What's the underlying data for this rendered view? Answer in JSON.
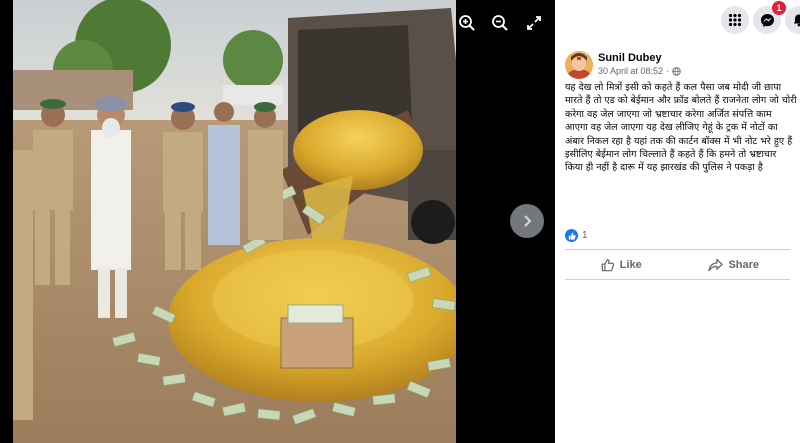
{
  "post": {
    "author_name": "Sunil Dubey",
    "timestamp": "30 April at 08:52",
    "privacy_icon": "globe-icon",
    "text": "यह देख लो मित्रों इसी को कहते हैं कल पैसा जब मोदी जी छापा मारते हैं तो एड को बेईमान और फ्रॉड बोलते हैं राजनेता लोग जो चोरी करेगा वह जेल जाएगा जो भ्रष्टाचार करेगा अर्जित संपत्ति काम आएगा वह जेल जाएगा यह देख लीजिए गेहूं के ट्रक में नोटों का अंबार निकल रहा है यहां तक की कार्टन बॉक्स में भी नोट भरे हुए हैं इसीलिए बेईमान लोग चिल्लाते हैं कहते हैं कि हमने तो भ्रष्टाचार किया ही नहीं है दारू में यह झारखंड की पुलिस ने पकड़ा है",
    "reaction_count": "1",
    "like_label": "Like",
    "share_label": "Share"
  },
  "topbar": {
    "menu_icon": "grid-menu-icon",
    "messenger_icon": "messenger-icon",
    "messenger_badge": "1",
    "notifications_icon": "bell-icon"
  },
  "viewer": {
    "zoom_in_icon": "zoom-in-icon",
    "zoom_out_icon": "zoom-out-icon",
    "fullscreen_icon": "fullscreen-icon",
    "next_icon": "chevron-right-icon"
  },
  "colors": {
    "brand": "#1877f2",
    "badge": "#e41e3f",
    "gold": "#d4a82a",
    "cash": "#b9cfa8"
  }
}
